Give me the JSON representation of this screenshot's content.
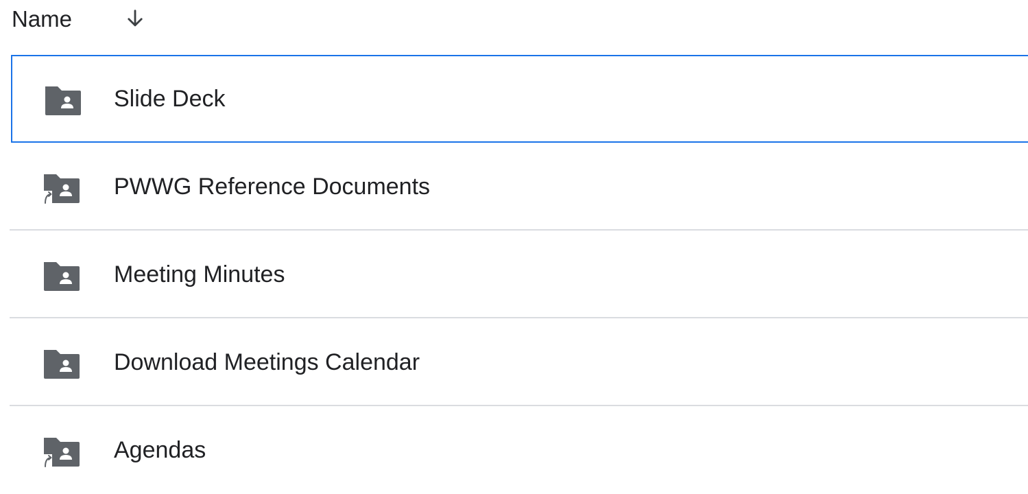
{
  "header": {
    "name_label": "Name",
    "sort_icon": "arrow-down-icon"
  },
  "colors": {
    "selection_border": "#1a73e8",
    "folder_icon": "#5f6368",
    "divider": "#dadce0"
  },
  "rows": [
    {
      "label": "Slide Deck",
      "icon": "shared-folder-icon",
      "selected": true
    },
    {
      "label": "PWWG Reference Documents",
      "icon": "shared-folder-shortcut-icon",
      "selected": false
    },
    {
      "label": "Meeting Minutes",
      "icon": "shared-folder-icon",
      "selected": false
    },
    {
      "label": "Download Meetings Calendar",
      "icon": "shared-folder-icon",
      "selected": false
    },
    {
      "label": "Agendas",
      "icon": "shared-folder-shortcut-icon",
      "selected": false
    }
  ]
}
